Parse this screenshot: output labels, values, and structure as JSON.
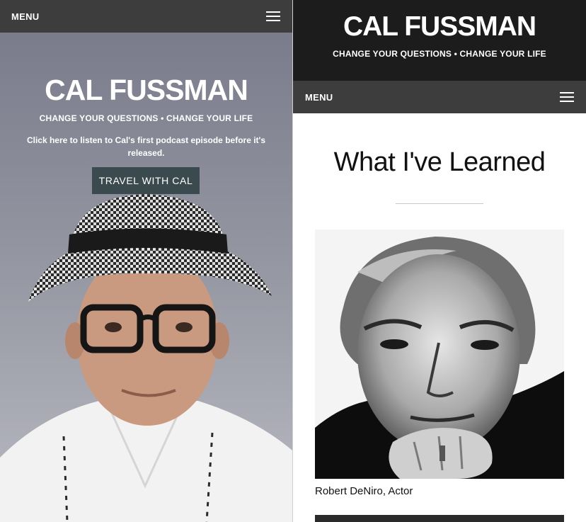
{
  "left": {
    "menu_label": "MENU",
    "hero": {
      "title": "CAL FUSSMAN",
      "tagline": "CHANGE YOUR QUESTIONS • CHANGE YOUR LIFE",
      "podcast_link": "Click here to listen to Cal's first podcast episode before it's released.",
      "cta_label": "TRAVEL WITH CAL"
    }
  },
  "right": {
    "header": {
      "title": "CAL FUSSMAN",
      "tagline": "CHANGE YOUR QUESTIONS • CHANGE YOUR LIFE"
    },
    "menu_label": "MENU",
    "section": {
      "title": "What I've Learned"
    },
    "featured": {
      "caption": "Robert DeNiro, Actor"
    }
  },
  "colors": {
    "menu_bar": "#3d3d3d",
    "header_bg": "#1c1c1c",
    "cta_bg": "#3b4a4f",
    "hero_bg": "#8a8b97"
  },
  "icons": {
    "menu": "hamburger-icon"
  }
}
